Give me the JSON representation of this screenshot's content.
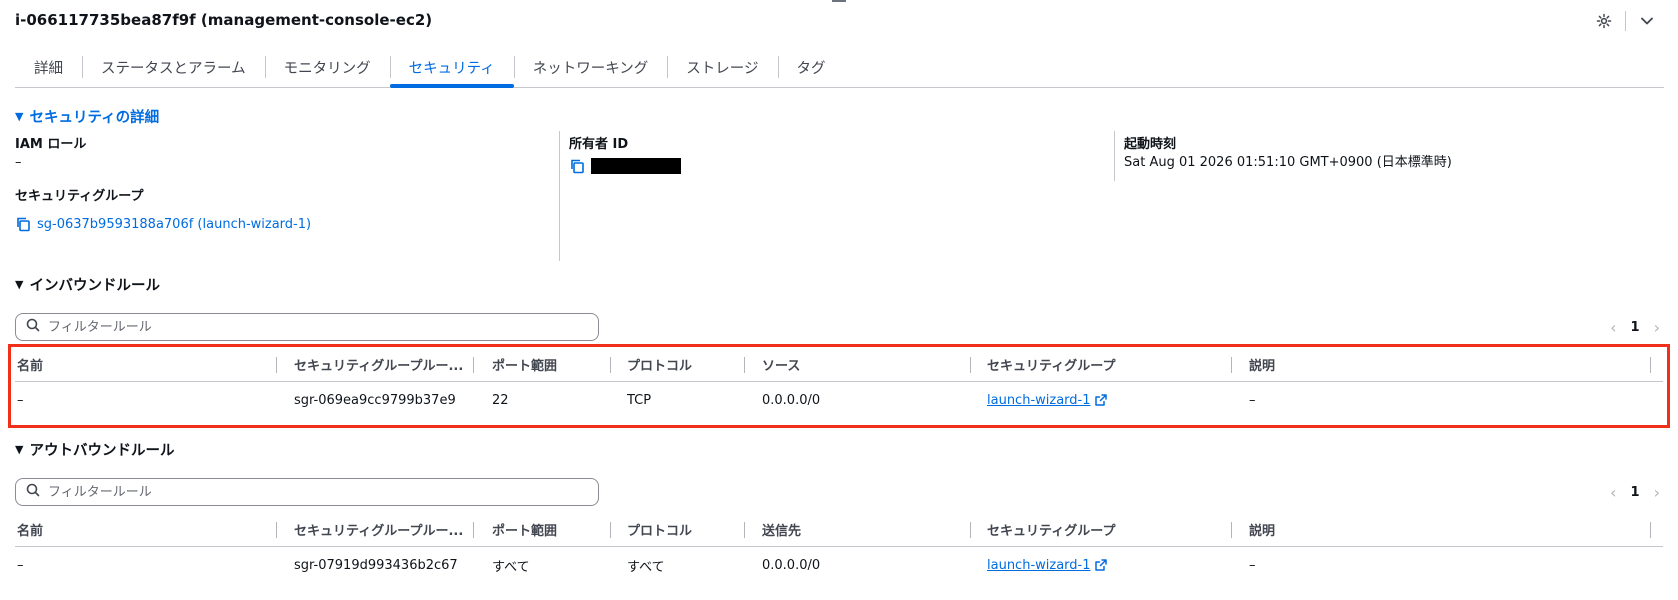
{
  "instance_title": "i-066117735bea87f9f (management-console-ec2)",
  "icons": {
    "settings": "settings-icon",
    "collapse": "chevron-down-icon",
    "copy": "copy-icon",
    "search": "search-icon",
    "external": "external-link-icon"
  },
  "tabs": [
    {
      "label": "詳細",
      "active": false
    },
    {
      "label": "ステータスとアラーム",
      "active": false
    },
    {
      "label": "モニタリング",
      "active": false
    },
    {
      "label": "セキュリティ",
      "active": true
    },
    {
      "label": "ネットワーキング",
      "active": false
    },
    {
      "label": "ストレージ",
      "active": false
    },
    {
      "label": "タグ",
      "active": false
    }
  ],
  "security_details": {
    "toggle_label": "セキュリティの詳細",
    "iam_role_label": "IAM ロール",
    "iam_role_value": "–",
    "owner_id_label": "所有者 ID",
    "launch_time_label": "起動時刻",
    "launch_time_value": "Sat Aug 01 2026 01:51:10 GMT+0900 (日本標準時)",
    "security_groups_label": "セキュリティグループ",
    "security_group_link": "sg-0637b9593188a706f (launch-wizard-1)"
  },
  "inbound": {
    "toggle_label": "インバウンドルール",
    "filter_placeholder": "フィルタールール",
    "page": "1",
    "columns": [
      "名前",
      "セキュリティグループルー...",
      "ポート範囲",
      "プロトコル",
      "ソース",
      "セキュリティグループ",
      "説明"
    ],
    "rows": [
      {
        "name": "–",
        "rule_id": "sgr-069ea9cc9799b37e9",
        "port": "22",
        "protocol": "TCP",
        "source": "0.0.0.0/0",
        "security_group": "launch-wizard-1",
        "description": "–"
      }
    ]
  },
  "outbound": {
    "toggle_label": "アウトバウンドルール",
    "filter_placeholder": "フィルタールール",
    "page": "1",
    "columns": [
      "名前",
      "セキュリティグループルー...",
      "ポート範囲",
      "プロトコル",
      "送信先",
      "セキュリティグループ",
      "説明"
    ],
    "rows": [
      {
        "name": "–",
        "rule_id": "sgr-07919d993436b2c67",
        "port": "すべて",
        "protocol": "すべて",
        "destination": "0.0.0.0/0",
        "security_group": "launch-wizard-1",
        "description": "–"
      }
    ]
  },
  "colors": {
    "accent": "#006ce0",
    "highlight_border": "#f0301a",
    "text": "#0f141a",
    "divider": "#c6c6cd"
  }
}
